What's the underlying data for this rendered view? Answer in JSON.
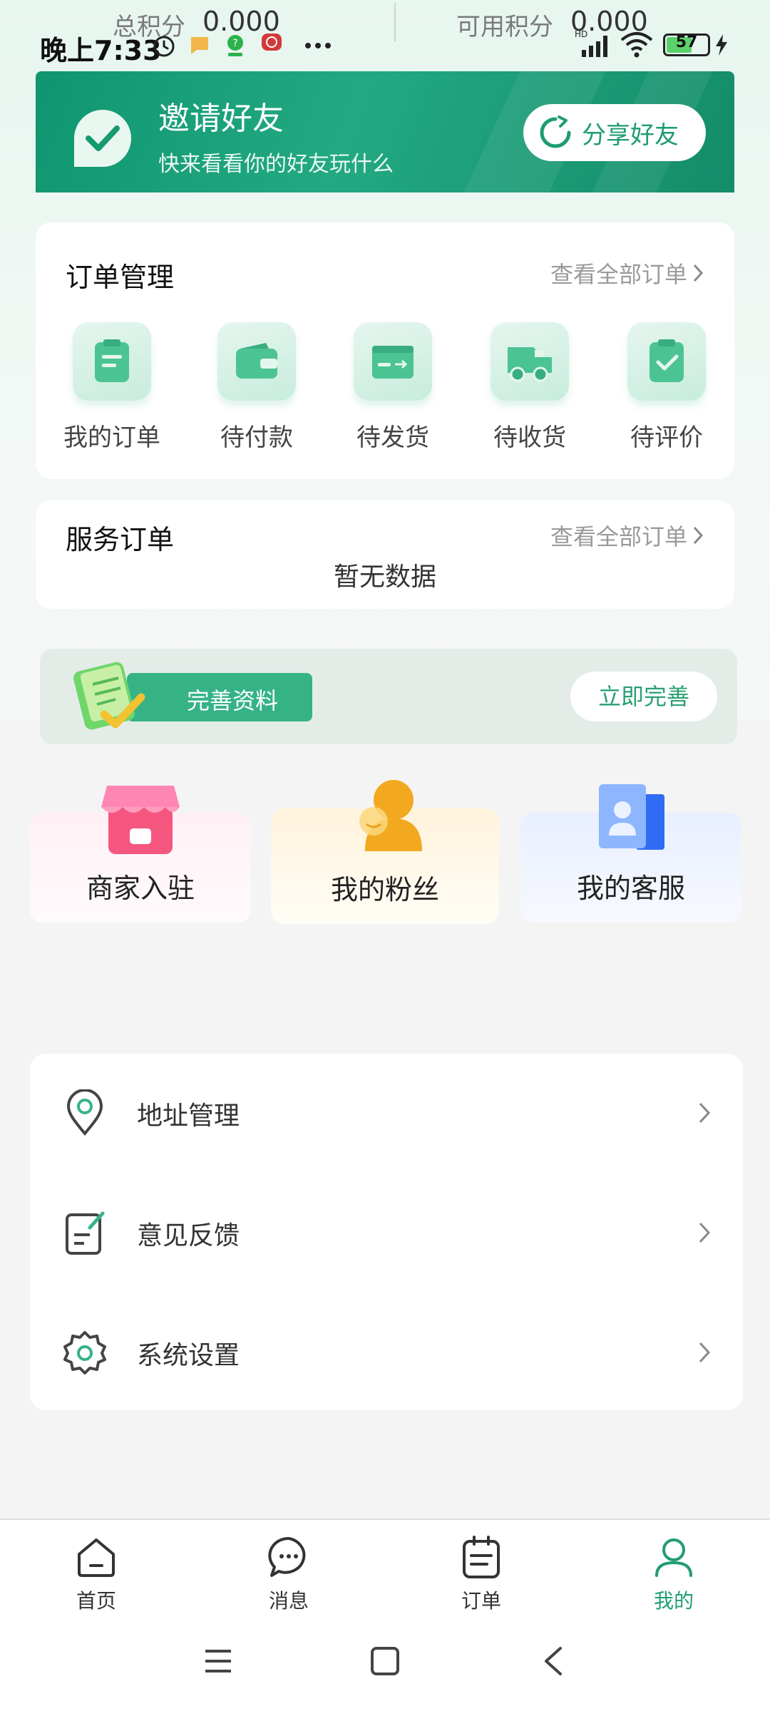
{
  "status_bar": {
    "time": "晚上7:33",
    "battery": "57",
    "network": "HD"
  },
  "points": {
    "total_label": "总积分",
    "total_value": "0.000",
    "available_label": "可用积分",
    "available_value": "0.000"
  },
  "invite": {
    "title": "邀请好友",
    "subtitle": "快来看看你的好友玩什么",
    "share_label": "分享好友"
  },
  "order_management": {
    "title": "订单管理",
    "view_all": "查看全部订单",
    "items": [
      {
        "label": "我的订单",
        "icon": "clipboard-icon"
      },
      {
        "label": "待付款",
        "icon": "wallet-icon"
      },
      {
        "label": "待发货",
        "icon": "box-icon"
      },
      {
        "label": "待收货",
        "icon": "truck-icon"
      },
      {
        "label": "待评价",
        "icon": "review-icon"
      }
    ]
  },
  "service_orders": {
    "title": "服务订单",
    "view_all": "查看全部订单",
    "empty_text": "暂无数据"
  },
  "complete_profile": {
    "label": "完善资料",
    "button": "立即完善"
  },
  "features": [
    {
      "label": "商家入驻",
      "icon": "store-icon"
    },
    {
      "label": "我的粉丝",
      "icon": "fans-icon"
    },
    {
      "label": "我的客服",
      "icon": "customer-service-icon"
    }
  ],
  "menu": [
    {
      "label": "地址管理",
      "icon": "location-pin-icon"
    },
    {
      "label": "意见反馈",
      "icon": "feedback-icon"
    },
    {
      "label": "系统设置",
      "icon": "settings-gear-icon"
    }
  ],
  "bottom_nav": [
    {
      "label": "首页",
      "icon": "home-icon"
    },
    {
      "label": "消息",
      "icon": "message-icon"
    },
    {
      "label": "订单",
      "icon": "order-icon"
    },
    {
      "label": "我的",
      "icon": "user-icon",
      "active": true
    }
  ],
  "colors": {
    "brand_green": "#1f9d72",
    "banner_green": "#139a70",
    "background": "#f4f4f4"
  }
}
